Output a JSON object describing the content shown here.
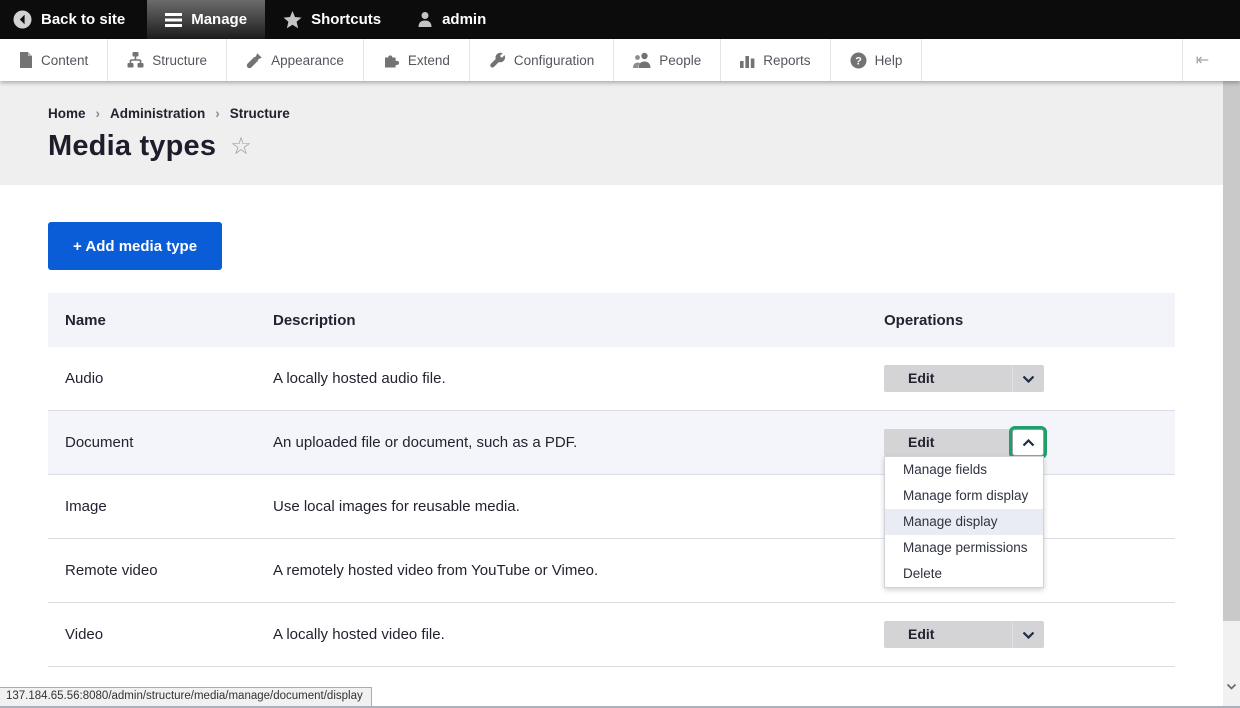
{
  "admin_bar": {
    "back_to_site": "Back to site",
    "manage": "Manage",
    "shortcuts": "Shortcuts",
    "user": "admin"
  },
  "toolbar": {
    "items": [
      {
        "label": "Content",
        "icon": "file-icon"
      },
      {
        "label": "Structure",
        "icon": "sitemap-icon"
      },
      {
        "label": "Appearance",
        "icon": "paintbrush-icon"
      },
      {
        "label": "Extend",
        "icon": "puzzle-icon"
      },
      {
        "label": "Configuration",
        "icon": "wrench-icon"
      },
      {
        "label": "People",
        "icon": "people-icon"
      },
      {
        "label": "Reports",
        "icon": "bar-chart-icon"
      },
      {
        "label": "Help",
        "icon": "question-icon"
      }
    ]
  },
  "breadcrumb": {
    "items": [
      "Home",
      "Administration",
      "Structure"
    ],
    "separator": "›"
  },
  "page": {
    "title": "Media types"
  },
  "actions": {
    "add_media_type": "+ Add media type"
  },
  "table": {
    "headers": {
      "name": "Name",
      "description": "Description",
      "operations": "Operations"
    },
    "rows": [
      {
        "name": "Audio",
        "description": "A locally hosted audio file.",
        "operation": "Edit"
      },
      {
        "name": "Document",
        "description": "An uploaded file or document, such as a PDF.",
        "operation": "Edit",
        "state": "dropdown-open"
      },
      {
        "name": "Image",
        "description": "Use local images for reusable media."
      },
      {
        "name": "Remote video",
        "description": "A remotely hosted video from YouTube or Vimeo."
      },
      {
        "name": "Video",
        "description": "A locally hosted video file.",
        "operation": "Edit"
      }
    ]
  },
  "dropdown_menu": {
    "items": [
      {
        "label": "Manage fields"
      },
      {
        "label": "Manage form display"
      },
      {
        "label": "Manage display",
        "highlighted": true
      },
      {
        "label": "Manage permissions"
      },
      {
        "label": "Delete"
      }
    ]
  },
  "status_bar": {
    "url": "137.184.65.56:8080/admin/structure/media/manage/document/display"
  },
  "colors": {
    "primary_blue": "#0b5cd7",
    "focus_green": "#1fa06b",
    "admin_bar_bg": "#0c0c0c",
    "page_header_bg": "#efefef",
    "table_header_bg": "#f3f4f9",
    "row_highlight": "#f4f5fa",
    "button_gray": "#d4d4d6",
    "text_dark": "#222330"
  }
}
